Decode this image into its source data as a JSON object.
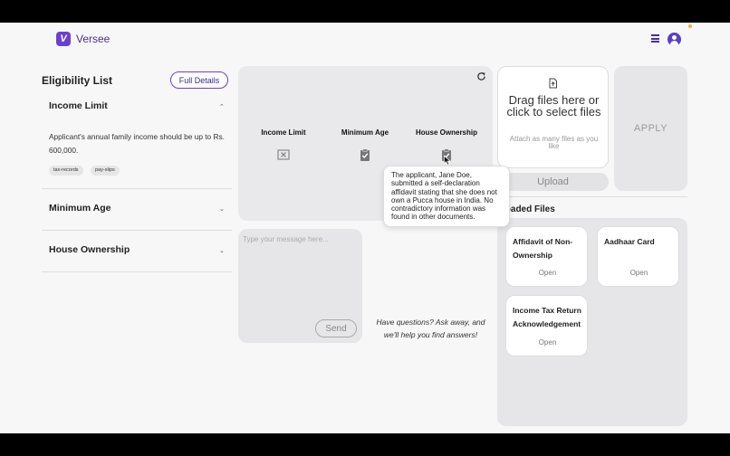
{
  "app": {
    "name": "Versee",
    "logo_letter": "V",
    "accent": "#6b3fd0"
  },
  "header": {
    "menu_icon": "hamburger-menu-icon",
    "avatar_icon": "user-avatar-icon"
  },
  "eligibility": {
    "title": "Eligibility List",
    "full_details_label": "Full Details",
    "items": [
      {
        "label": "Income Limit",
        "expanded": true,
        "description": "Applicant's annual family income should be up to Rs. 600,000.",
        "tags": [
          "tax-records",
          "pay-slips"
        ]
      },
      {
        "label": "Minimum Age",
        "expanded": false
      },
      {
        "label": "House Ownership",
        "expanded": false
      }
    ]
  },
  "status_panel": {
    "columns": [
      {
        "label": "Income Limit",
        "status": "failed",
        "icon": "x-box-icon"
      },
      {
        "label": "Minimum Age",
        "status": "verified",
        "icon": "clipboard-check-icon"
      },
      {
        "label": "House Ownership",
        "status": "verified",
        "icon": "clipboard-check-icon"
      }
    ],
    "tooltip": "The applicant, Jane Doe, submitted a self-declaration affidavit stating that she does not own a Pucca house in India. No contradictory information was found in other documents."
  },
  "upload": {
    "drag_text": "Drag files here or click to select files",
    "attach_text": "Attach as many files as you like",
    "upload_label": "Upload",
    "apply_label": "APPLY"
  },
  "files": {
    "title": "loaded Files",
    "items": [
      {
        "name": "Affidavit of Non-Ownership",
        "action": "Open"
      },
      {
        "name": "Aadhaar Card",
        "action": "Open"
      },
      {
        "name": "Income Tax Return Acknowledgement",
        "action": "Open"
      }
    ]
  },
  "chat": {
    "placeholder": "Type your message here...",
    "send_label": "Send",
    "help_text": "Have questions? Ask away, and we'll help you find answers!"
  }
}
